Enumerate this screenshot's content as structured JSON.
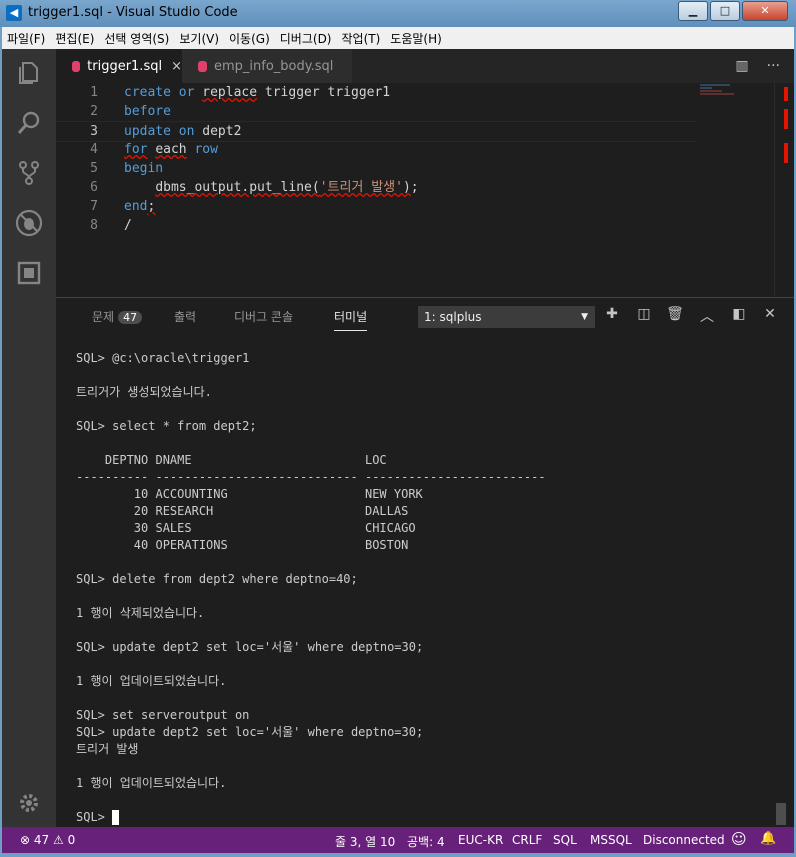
{
  "window": {
    "title": "trigger1.sql - Visual Studio Code",
    "app_icon": "vscode-icon"
  },
  "menu": [
    "파일(F)",
    "편집(E)",
    "선택 영역(S)",
    "보기(V)",
    "이동(G)",
    "디버그(D)",
    "작업(T)",
    "도움말(H)"
  ],
  "tabs": [
    {
      "label": "trigger1.sql",
      "close": "×"
    },
    {
      "label": "emp_info_body.sql"
    }
  ],
  "editor": {
    "line_numbers": [
      "1",
      "2",
      "3",
      "4",
      "5",
      "6",
      "7",
      "8"
    ]
  },
  "panel": {
    "tabs": {
      "problems": "문제",
      "problems_count": "47",
      "output": "출력",
      "debug": "디버그 콘솔",
      "terminal": "터미널"
    },
    "terminal_select": "1: sqlplus",
    "terminal_lines": [
      "SQL> @c:\\oracle\\trigger1",
      "",
      "트리거가 생성되었습니다.",
      "",
      "SQL> select * from dept2;",
      "",
      "    DEPTNO DNAME                        LOC",
      "---------- ---------------------------- -------------------------",
      "        10 ACCOUNTING                   NEW YORK",
      "        20 RESEARCH                     DALLAS",
      "        30 SALES                        CHICAGO",
      "        40 OPERATIONS                   BOSTON",
      "",
      "SQL> delete from dept2 where deptno=40;",
      "",
      "1 행이 삭제되었습니다.",
      "",
      "SQL> update dept2 set loc='서울' where deptno=30;",
      "",
      "1 행이 업데이트되었습니다.",
      "",
      "SQL> set serveroutput on",
      "SQL> update dept2 set loc='서울' where deptno=30;",
      "트리거 발생",
      "",
      "1 행이 업데이트되었습니다.",
      "",
      "SQL> "
    ]
  },
  "status": {
    "errors": "47",
    "warnings": "0",
    "position": "줄 3, 열 10",
    "spaces": "공백: 4",
    "encoding": "EUC-KR",
    "eol": "CRLF",
    "language": "SQL",
    "connection_type": "MSSQL",
    "connection": "Disconnected"
  },
  "colors": {
    "statusbar": "#68217a",
    "keyword": "#569cd6",
    "string": "#ce9178",
    "error": "#e51400"
  }
}
